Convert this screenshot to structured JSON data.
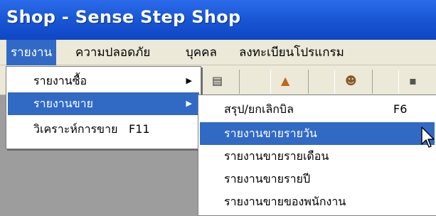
{
  "window": {
    "title": "Shop - Sense Step Shop"
  },
  "menubar": {
    "items": [
      {
        "label": "รายงาน"
      },
      {
        "label": "ความปลอดภัย"
      },
      {
        "label": "บุคคล"
      },
      {
        "label": "ลงทะเบียนโปรแกรม"
      }
    ]
  },
  "report_menu": {
    "items": [
      {
        "label": "รายงานซื้อ",
        "shortcut": ""
      },
      {
        "label": "รายงานขาย",
        "shortcut": ""
      },
      {
        "label": "วิเคราะห์การขาย",
        "shortcut": "F11"
      }
    ]
  },
  "sales_submenu": {
    "items": [
      {
        "label": "สรุป/ยกเลิกบิล",
        "shortcut": "F6"
      },
      {
        "label": "รายงานขายรายวัน",
        "shortcut": ""
      },
      {
        "label": "รายงานขายรายเดือน",
        "shortcut": ""
      },
      {
        "label": "รายงานขายรายปี",
        "shortcut": ""
      },
      {
        "label": "รายงานขายของพนักงาน",
        "shortcut": ""
      }
    ]
  },
  "toolbar": {
    "icons": [
      "toolbar-icon-1",
      "toolbar-icon-2",
      "toolbar-icon-3",
      "toolbar-icon-4"
    ]
  },
  "colors": {
    "titlebar": "#1a58d6",
    "highlight": "#316ac5",
    "menubar": "#ece9d8",
    "workarea": "#9d9d9d"
  }
}
